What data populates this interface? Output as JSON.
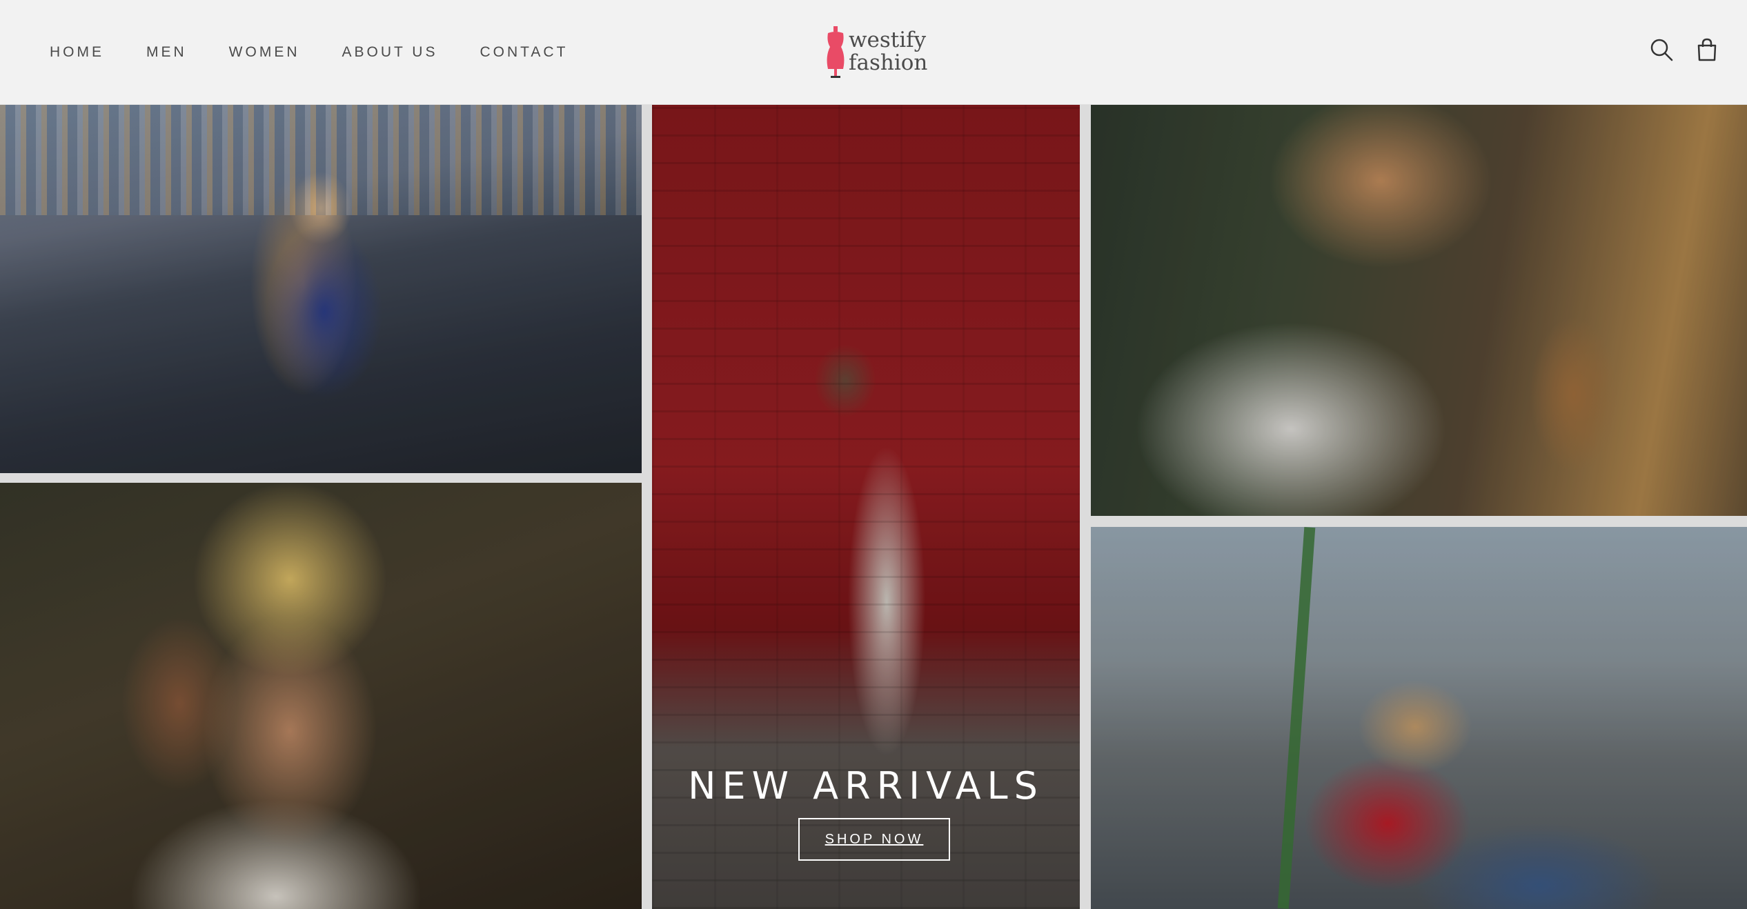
{
  "nav": {
    "items": [
      {
        "label": "HOME"
      },
      {
        "label": "MEN"
      },
      {
        "label": "WOMEN"
      },
      {
        "label": "ABOUT US"
      },
      {
        "label": "CONTACT"
      }
    ]
  },
  "logo": {
    "line1": "westify",
    "line2": "fashion",
    "mark_color": "#e94b66",
    "icon": "dress-form-icon"
  },
  "header_icons": {
    "search": "search-icon",
    "cart": "shopping-bag-icon"
  },
  "hero": {
    "title": "NEW ARRIVALS",
    "button_label": "SHOP NOW"
  },
  "gallery": {
    "tiles": [
      {
        "name": "woman-blue-shirt-ferris-wheel"
      },
      {
        "name": "couple-sunglasses"
      },
      {
        "name": "woman-red-brick-wall"
      },
      {
        "name": "man-sunglasses-closeup"
      },
      {
        "name": "woman-red-top-pointing"
      }
    ]
  }
}
